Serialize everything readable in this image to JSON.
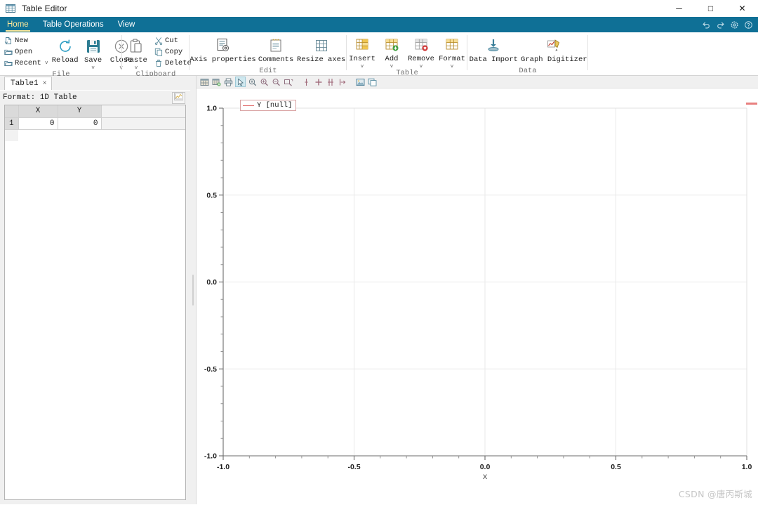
{
  "window": {
    "title": "Table Editor",
    "icon": "table-grid-icon",
    "minimize": "─",
    "maximize": "□",
    "close": "✕"
  },
  "ribbon": {
    "tabs": [
      {
        "label": "Home",
        "active": true
      },
      {
        "label": "Table Operations",
        "active": false
      },
      {
        "label": "View",
        "active": false
      }
    ],
    "quick_icons": [
      "undo-icon",
      "redo-icon",
      "gear-icon",
      "help-icon"
    ],
    "groups": [
      {
        "title": "File",
        "small_items": [
          {
            "label": "New",
            "icon": "new-document-icon"
          },
          {
            "label": "Open",
            "icon": "open-folder-icon"
          },
          {
            "label": "Recent",
            "icon": "recent-folder-icon",
            "caret": "˅"
          }
        ],
        "big_items": [
          {
            "label": "Reload",
            "icon": "reload-icon",
            "caret": ""
          },
          {
            "label": "Save",
            "icon": "save-disk-icon",
            "caret": "˅"
          },
          {
            "label": "Close",
            "icon": "close-circle-icon",
            "caret": "˅"
          }
        ]
      },
      {
        "title": "Clipboard",
        "big_items": [
          {
            "label": "Paste",
            "icon": "paste-icon",
            "caret": "˅"
          }
        ],
        "small_items": [
          {
            "label": "Cut",
            "icon": "scissors-icon"
          },
          {
            "label": "Copy",
            "icon": "copy-icon"
          },
          {
            "label": "Delete",
            "icon": "trash-icon"
          }
        ]
      },
      {
        "title": "Edit",
        "big_items": [
          {
            "label": "Axis properties",
            "icon": "axis-properties-icon",
            "caret": ""
          },
          {
            "label": "Comments",
            "icon": "comments-icon",
            "caret": ""
          },
          {
            "label": "Resize axes",
            "icon": "resize-axes-icon",
            "caret": ""
          }
        ]
      },
      {
        "title": "Table",
        "big_items": [
          {
            "label": "Insert",
            "icon": "insert-table-icon",
            "caret": "˅"
          },
          {
            "label": "Add",
            "icon": "add-table-icon",
            "caret": "˅"
          },
          {
            "label": "Remove",
            "icon": "remove-table-icon",
            "caret": "˅"
          },
          {
            "label": "Format",
            "icon": "format-table-icon",
            "caret": "˅"
          }
        ]
      },
      {
        "title": "Data",
        "big_items": [
          {
            "label": "Data Import",
            "icon": "data-import-icon",
            "caret": ""
          },
          {
            "label": "Graph Digitizer",
            "icon": "graph-digitizer-icon",
            "caret": ""
          }
        ]
      }
    ]
  },
  "left_pane": {
    "document_tab": {
      "label": "Table1",
      "close": "×"
    },
    "format_label": "Format: 1D Table",
    "chart_button_icon": "chart-preview-icon",
    "table": {
      "columns": [
        "X",
        "Y"
      ],
      "rows": [
        {
          "index": "1",
          "values": [
            "0",
            "0"
          ]
        }
      ]
    }
  },
  "plot_toolbar": {
    "buttons": [
      {
        "name": "new-plot-icon",
        "selected": false
      },
      {
        "name": "save-plot-icon",
        "selected": false
      },
      {
        "name": "print-icon",
        "selected": false
      },
      {
        "name": "pointer-select-icon",
        "selected": true
      },
      {
        "name": "pan-icon",
        "selected": false
      },
      {
        "name": "zoom-in-icon",
        "selected": false
      },
      {
        "name": "zoom-out-icon",
        "selected": false
      },
      {
        "name": "zoom-region-icon",
        "selected": false
      },
      {
        "name": "marker-single-icon",
        "selected": false
      },
      {
        "name": "marker-cross-icon",
        "selected": false
      },
      {
        "name": "marker-pair-icon",
        "selected": false
      },
      {
        "name": "marker-arrow-icon",
        "selected": false
      },
      {
        "name": "image-export-icon",
        "selected": false
      },
      {
        "name": "copy-plot-icon",
        "selected": false
      }
    ]
  },
  "chart_data": {
    "type": "line",
    "title": "",
    "xlabel": "X",
    "ylabel": "",
    "xlim": [
      -1.0,
      1.0
    ],
    "ylim": [
      -1.0,
      1.0
    ],
    "xticks": [
      "-1.0",
      "-0.5",
      "0.0",
      "0.5",
      "1.0"
    ],
    "xtick_values": [
      -1.0,
      -0.5,
      0.0,
      0.5,
      1.0
    ],
    "yticks": [
      "-1.0",
      "-0.5",
      "0.0",
      "0.5",
      "1.0"
    ],
    "ytick_values": [
      -1.0,
      -0.5,
      0.0,
      0.5,
      1.0
    ],
    "minor_ticks_per_major": 5,
    "grid": true,
    "legend_position": "top-left-outside",
    "series": [
      {
        "name": "Y [null]",
        "color": "#e06666",
        "x": [],
        "y": []
      }
    ]
  },
  "watermark": "CSDN @唐丙斯城"
}
